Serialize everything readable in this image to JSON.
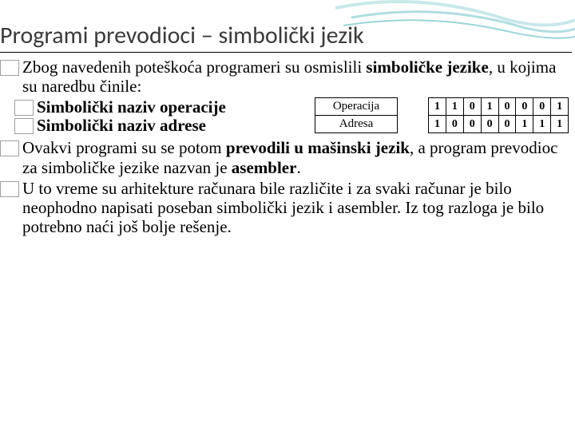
{
  "title": "Programi prevodioci – simbolički jezik",
  "p1": {
    "prefix": "Zbog navedenih poteškoća programeri su osmislili ",
    "bold": "simboličke jezike",
    "suffix": ", u kojima su naredbu činile:"
  },
  "sub1": "Simbolički naziv operacije",
  "sub2": "Simbolički naziv adrese",
  "labels": {
    "op": "Operacija",
    "addr": "Adresa"
  },
  "bits": {
    "row1": [
      "1",
      "1",
      "0",
      "1",
      "0",
      "0",
      "0",
      "1"
    ],
    "row2": [
      "1",
      "0",
      "0",
      "0",
      "0",
      "1",
      "1",
      "1"
    ]
  },
  "p2": {
    "prefix": "Ovakvi programi su se potom ",
    "bold1": "prevodili u mašinski jezik",
    "mid": ", a program prevodioc za simboličke jezike nazvan je ",
    "bold2": "asembler",
    "suffix": "."
  },
  "p3": "U to vreme su arhitekture računara bile različite i za svaki računar je bilo neophodno napisati poseban simbolički jezik i asembler. Iz tog razloga je bilo potrebno naći još bolje rešenje."
}
